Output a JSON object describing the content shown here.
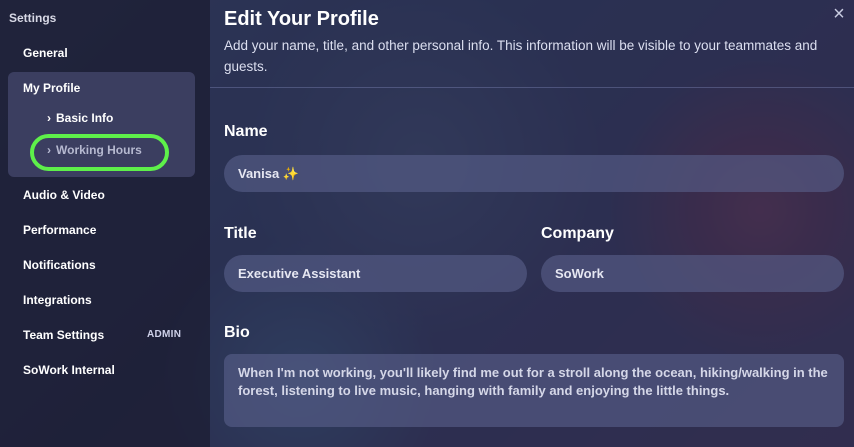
{
  "sidebar": {
    "title": "Settings",
    "items": {
      "general": "General",
      "my_profile": "My Profile",
      "basic_info": "Basic Info",
      "working_hours": "Working Hours",
      "audio_video": "Audio & Video",
      "performance": "Performance",
      "notifications": "Notifications",
      "integrations": "Integrations",
      "team_settings": "Team Settings",
      "sowork_internal": "SoWork Internal"
    },
    "admin_badge": "ADMIN",
    "chevron": "›"
  },
  "main": {
    "title": "Edit Your Profile",
    "subtitle": "Add your name, title, and other personal info. This information will be visible to your teammates and guests.",
    "close_icon": "×",
    "name": {
      "label": "Name",
      "value": "Vanisa ✨"
    },
    "title_field": {
      "label": "Title",
      "value": "Executive Assistant"
    },
    "company": {
      "label": "Company",
      "value": "SoWork"
    },
    "bio": {
      "label": "Bio",
      "value": "When I'm not working, you'll likely find me out for a stroll along the ocean, hiking/walking in the forest, listening to live music, hanging with family and enjoying the little things."
    }
  },
  "colors": {
    "highlight": "#5ef04a",
    "sidebar_bg": "#1c1e34",
    "field_bg": "#5a608c"
  }
}
